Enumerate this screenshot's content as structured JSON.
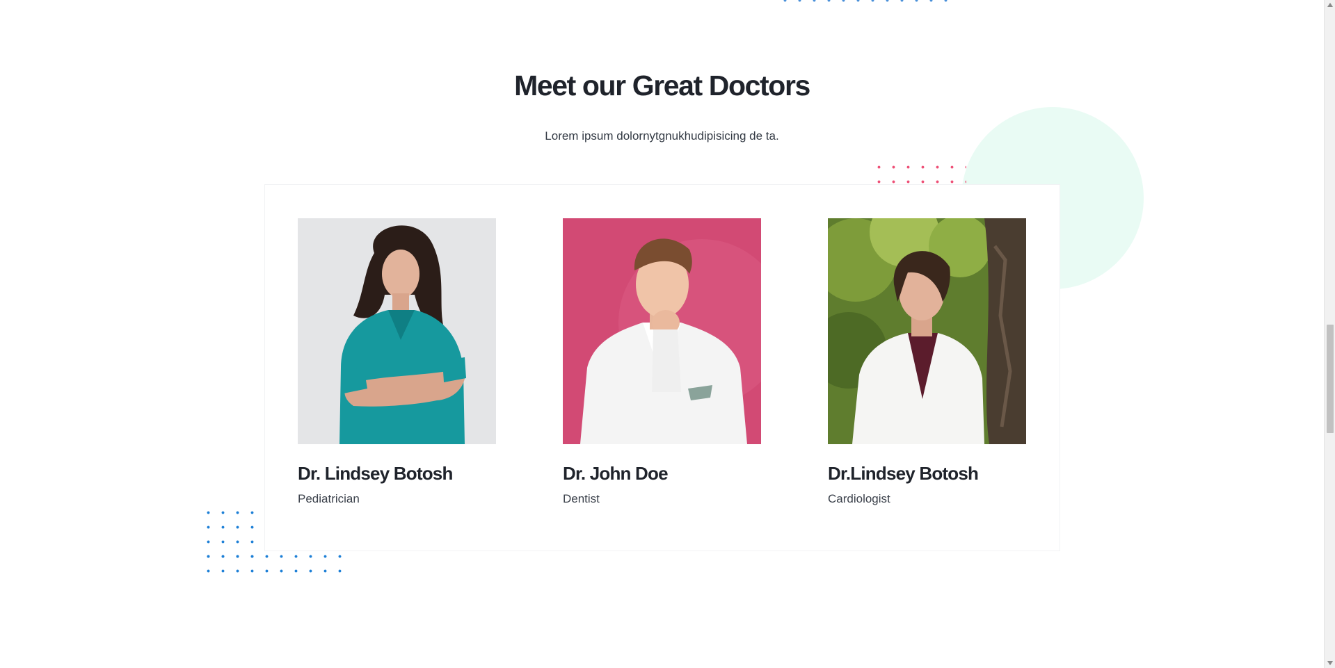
{
  "section": {
    "title": "Meet our Great Doctors",
    "subtitle": "Lorem ipsum dolornytgnukhudipisicing de ta."
  },
  "doctors": [
    {
      "name": "Dr. Lindsey Botosh",
      "role": "Pediatrician",
      "photo_icon": "doctor-portrait-teal-scrubs"
    },
    {
      "name": "Dr. John Doe",
      "role": "Dentist",
      "photo_icon": "doctor-portrait-pink-background"
    },
    {
      "name": "Dr.Lindsey Botosh",
      "role": "Cardiologist",
      "photo_icon": "doctor-portrait-white-coat-trees"
    }
  ],
  "colors": {
    "heading": "#1f232b",
    "accent_blue": "#1c7fd6",
    "accent_pink": "#ee4f76",
    "mint": "#e9fbf4"
  }
}
